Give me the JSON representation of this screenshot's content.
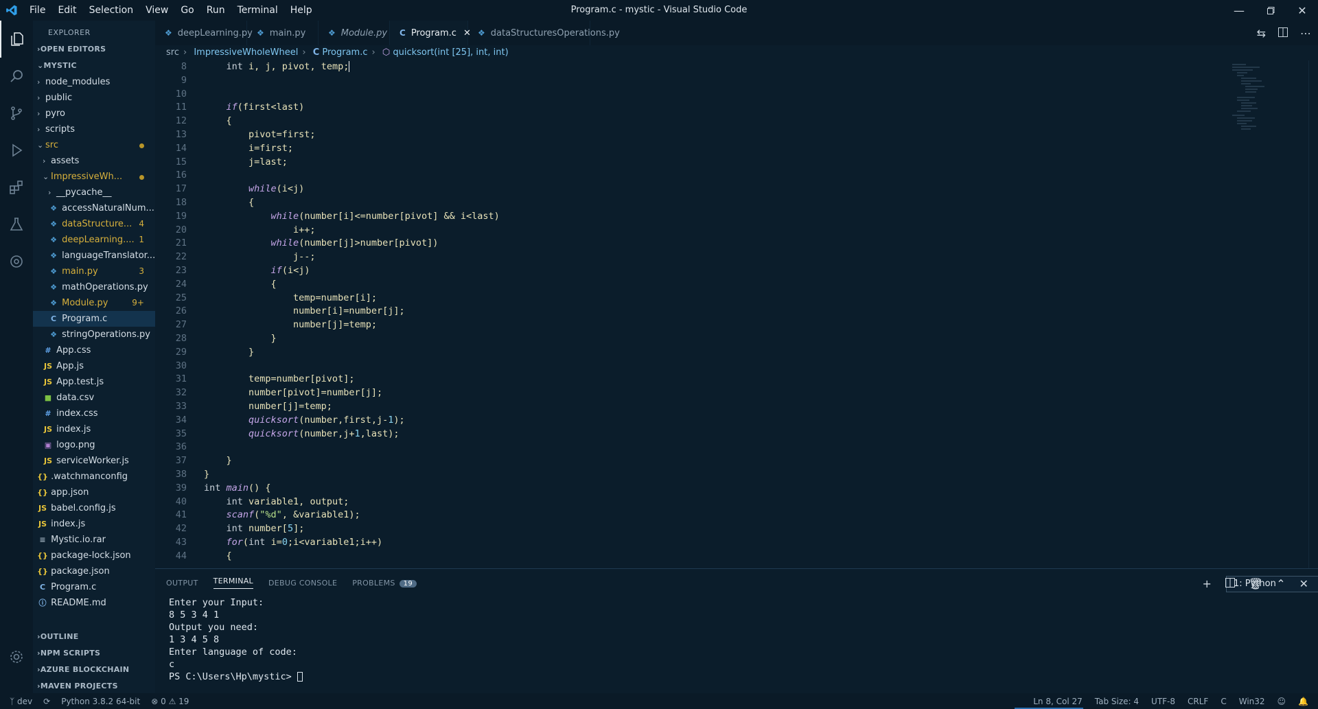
{
  "window": {
    "title": "Program.c - mystic - Visual Studio Code"
  },
  "menu": [
    "File",
    "Edit",
    "Selection",
    "View",
    "Go",
    "Run",
    "Terminal",
    "Help"
  ],
  "explorer": {
    "header": "EXPLORER",
    "open_editors": "OPEN EDITORS",
    "root": "MYSTIC",
    "tree": [
      {
        "label": "node_modules",
        "type": "folder",
        "depth": 1,
        "open": false
      },
      {
        "label": "public",
        "type": "folder",
        "depth": 1,
        "open": false
      },
      {
        "label": "pyro",
        "type": "folder",
        "depth": 1,
        "open": false
      },
      {
        "label": "scripts",
        "type": "folder",
        "depth": 1,
        "open": false
      },
      {
        "label": "src",
        "type": "folder",
        "depth": 1,
        "open": true,
        "modified": true,
        "dot": true
      },
      {
        "label": "assets",
        "type": "folder",
        "depth": 2,
        "open": false
      },
      {
        "label": "ImpressiveWh...",
        "type": "folder",
        "depth": 2,
        "open": true,
        "modified": true,
        "dot": true
      },
      {
        "label": "__pycache__",
        "type": "folder",
        "depth": 3,
        "open": false
      },
      {
        "label": "accessNaturalNum...",
        "type": "py",
        "depth": 3
      },
      {
        "label": "dataStructure...",
        "type": "py",
        "depth": 3,
        "modified": true,
        "badge": "4"
      },
      {
        "label": "deepLearning....",
        "type": "py",
        "depth": 3,
        "modified": true,
        "badge": "1"
      },
      {
        "label": "languageTranslator...",
        "type": "py",
        "depth": 3
      },
      {
        "label": "main.py",
        "type": "py",
        "depth": 3,
        "modified": true,
        "badge": "3"
      },
      {
        "label": "mathOperations.py",
        "type": "py",
        "depth": 3
      },
      {
        "label": "Module.py",
        "type": "py",
        "depth": 3,
        "modified": true,
        "badge": "9+"
      },
      {
        "label": "Program.c",
        "type": "c",
        "depth": 3,
        "selected": true
      },
      {
        "label": "stringOperations.py",
        "type": "py",
        "depth": 3
      },
      {
        "label": "App.css",
        "type": "css",
        "depth": 2
      },
      {
        "label": "App.js",
        "type": "js",
        "depth": 2
      },
      {
        "label": "App.test.js",
        "type": "js",
        "depth": 2
      },
      {
        "label": "data.csv",
        "type": "csv",
        "depth": 2
      },
      {
        "label": "index.css",
        "type": "css",
        "depth": 2
      },
      {
        "label": "index.js",
        "type": "js",
        "depth": 2
      },
      {
        "label": "logo.png",
        "type": "img",
        "depth": 2
      },
      {
        "label": "serviceWorker.js",
        "type": "js",
        "depth": 2
      },
      {
        "label": ".watchmanconfig",
        "type": "json",
        "depth": 1
      },
      {
        "label": "app.json",
        "type": "json",
        "depth": 1
      },
      {
        "label": "babel.config.js",
        "type": "js",
        "depth": 1
      },
      {
        "label": "index.js",
        "type": "js",
        "depth": 1
      },
      {
        "label": "Mystic.io.rar",
        "type": "rar",
        "depth": 1
      },
      {
        "label": "package-lock.json",
        "type": "json",
        "depth": 1
      },
      {
        "label": "package.json",
        "type": "json",
        "depth": 1
      },
      {
        "label": "Program.c",
        "type": "c",
        "depth": 1
      },
      {
        "label": "README.md",
        "type": "md",
        "depth": 1
      }
    ],
    "bottom_sections": [
      "OUTLINE",
      "NPM SCRIPTS",
      "AZURE BLOCKCHAIN",
      "MAVEN PROJECTS"
    ]
  },
  "tabs": [
    {
      "label": "deepLearning.py",
      "icon": "py",
      "italic": false
    },
    {
      "label": "main.py",
      "icon": "py",
      "italic": false
    },
    {
      "label": "Module.py",
      "icon": "py",
      "italic": true
    },
    {
      "label": "Program.c",
      "icon": "c",
      "active": true
    },
    {
      "label": "dataStructuresOperations.py",
      "icon": "py",
      "italic": false
    }
  ],
  "breadcrumb": [
    "src",
    "ImpressiveWholeWheel",
    "Program.c",
    "quicksort(int [25], int, int)"
  ],
  "code": [
    {
      "n": "8",
      "t": "    int i, j, pivot, temp;"
    },
    {
      "n": "9",
      "t": ""
    },
    {
      "n": "10",
      "t": ""
    },
    {
      "n": "11",
      "t": "    if(first<last)"
    },
    {
      "n": "12",
      "t": "    {"
    },
    {
      "n": "13",
      "t": "        pivot=first;"
    },
    {
      "n": "14",
      "t": "        i=first;"
    },
    {
      "n": "15",
      "t": "        j=last;"
    },
    {
      "n": "16",
      "t": ""
    },
    {
      "n": "17",
      "t": "        while(i<j)"
    },
    {
      "n": "18",
      "t": "        {"
    },
    {
      "n": "19",
      "t": "            while(number[i]<=number[pivot] && i<last)"
    },
    {
      "n": "20",
      "t": "                i++;"
    },
    {
      "n": "21",
      "t": "            while(number[j]>number[pivot])"
    },
    {
      "n": "22",
      "t": "                j--;"
    },
    {
      "n": "23",
      "t": "            if(i<j)"
    },
    {
      "n": "24",
      "t": "            {"
    },
    {
      "n": "25",
      "t": "                temp=number[i];"
    },
    {
      "n": "26",
      "t": "                number[i]=number[j];"
    },
    {
      "n": "27",
      "t": "                number[j]=temp;"
    },
    {
      "n": "28",
      "t": "            }"
    },
    {
      "n": "29",
      "t": "        }"
    },
    {
      "n": "30",
      "t": ""
    },
    {
      "n": "31",
      "t": "        temp=number[pivot];"
    },
    {
      "n": "32",
      "t": "        number[pivot]=number[j];"
    },
    {
      "n": "33",
      "t": "        number[j]=temp;"
    },
    {
      "n": "34",
      "t": "        quicksort(number,first,j-1);"
    },
    {
      "n": "35",
      "t": "        quicksort(number,j+1,last);"
    },
    {
      "n": "36",
      "t": ""
    },
    {
      "n": "37",
      "t": "    }"
    },
    {
      "n": "38",
      "t": "}"
    },
    {
      "n": "39",
      "t": "int main() {"
    },
    {
      "n": "40",
      "t": "    int variable1, output;"
    },
    {
      "n": "41",
      "t": "    scanf(\"%d\", &variable1);"
    },
    {
      "n": "42",
      "t": "    int number[5];"
    },
    {
      "n": "43",
      "t": "    for(int i=0;i<variable1;i++)"
    },
    {
      "n": "44",
      "t": "    {"
    }
  ],
  "panel": {
    "tabs": [
      "OUTPUT",
      "TERMINAL",
      "DEBUG CONSOLE",
      "PROBLEMS"
    ],
    "problems_count": "19",
    "terminal_select": "1: Python",
    "terminal_lines": [
      "Enter your Input:",
      "8 5 3 4 1",
      "Output you need:",
      "1 3 4 5 8",
      "Enter language of code:",
      "c",
      "PS C:\\Users\\Hp\\mystic> "
    ]
  },
  "status": {
    "branch": "dev",
    "python": "Python 3.8.2 64-bit",
    "errors": "0",
    "warnings": "19",
    "position": "Ln 8, Col 27",
    "tabsize": "Tab Size: 4",
    "encoding": "UTF-8",
    "eol": "CRLF",
    "language": "C",
    "platform": "Win32"
  },
  "colors": {
    "accent": "#0b1d2b",
    "modified": "#d7b03c",
    "py_icon": "#4e9bd1",
    "c_icon": "#7fb3e6",
    "js_icon": "#e8c53a"
  }
}
